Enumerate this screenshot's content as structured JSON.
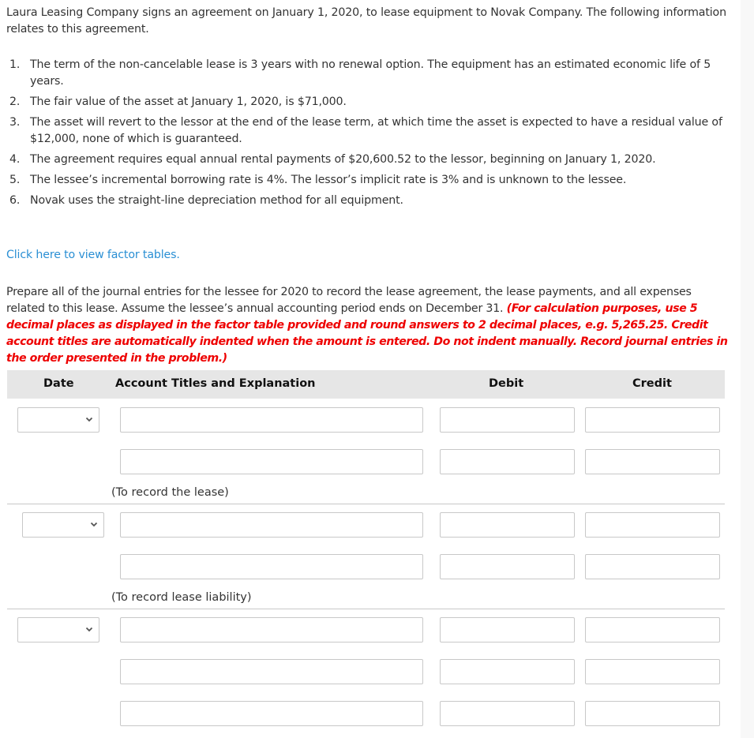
{
  "problem": {
    "intro": "Laura Leasing Company signs an agreement on January 1, 2020, to lease equipment to Novak Company. The following information relates to this agreement.",
    "facts": [
      {
        "num": "1.",
        "text": "The term of the non-cancelable lease is 3 years with no renewal option. The equipment has an estimated economic life of 5 years."
      },
      {
        "num": "2.",
        "text": "The fair value of the asset at January 1, 2020, is $71,000."
      },
      {
        "num": "3.",
        "text": "The asset will revert to the lessor at the end of the lease term, at which time the asset is expected to have a residual value of $12,000, none of which is guaranteed."
      },
      {
        "num": "4.",
        "text": "The agreement requires equal annual rental payments of $20,600.52 to the lessor, beginning on January 1, 2020."
      },
      {
        "num": "5.",
        "text": "The lessee’s incremental borrowing rate is 4%. The lessor’s implicit rate is 3% and is unknown to the lessee."
      },
      {
        "num": "6.",
        "text": "Novak uses the straight-line depreciation method for all equipment."
      }
    ],
    "factor_link": "Click here to view factor tables.",
    "instructions": "Prepare all of the journal entries for the lessee for 2020 to record the lease agreement, the lease payments, and all expenses related to this lease. Assume the lessee’s annual accounting period ends on December 31. ",
    "instructions_red": "(For calculation purposes, use 5 decimal places as displayed in the factor table provided and round answers to 2 decimal places, e.g. 5,265.25. Credit account titles are automatically indented when the amount is entered. Do not indent manually. Record journal entries in the order presented in the problem.)"
  },
  "journal": {
    "headers": {
      "date": "Date",
      "account": "Account Titles and Explanation",
      "debit": "Debit",
      "credit": "Credit"
    },
    "entries": [
      {
        "date": "",
        "note": "(To record the lease)",
        "lines": [
          {
            "account": "",
            "debit": "",
            "credit": ""
          },
          {
            "account": "",
            "debit": "",
            "credit": ""
          }
        ]
      },
      {
        "date": "",
        "note": "(To record lease liability)",
        "lines": [
          {
            "account": "",
            "debit": "",
            "credit": ""
          },
          {
            "account": "",
            "debit": "",
            "credit": ""
          }
        ]
      },
      {
        "date": "",
        "note": "",
        "lines": [
          {
            "account": "",
            "debit": "",
            "credit": ""
          },
          {
            "account": "",
            "debit": "",
            "credit": ""
          },
          {
            "account": "",
            "debit": "",
            "credit": ""
          }
        ]
      }
    ]
  },
  "colors": {
    "link": "#2a8fd4",
    "warning": "#ee0000",
    "header_bg": "#e6e6e6",
    "border": "#c8c8c8"
  }
}
